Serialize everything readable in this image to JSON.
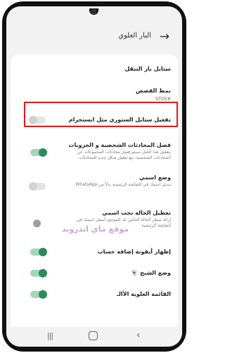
{
  "header": {
    "title": "البار العلوي",
    "back_icon": "arrow-right-icon"
  },
  "settings": [
    {
      "key": "statusbar_style",
      "label": "ستايل بار التنقل"
    },
    {
      "key": "stories_mode",
      "label": "نمط القصص",
      "value": "STOCK"
    },
    {
      "key": "insta_stories",
      "label": "تفعيل ستايل الستوري مثل انستجرام",
      "toggle": false,
      "highlighted": true
    },
    {
      "key": "separate_chats",
      "label": "فصل المحادثات الشخصية و الجروبات",
      "sub": "بتفعيل هذا الخيار سيتم فصل محادثات المجموعات عن المحادثات الشخصية، مع تفعيل شكل جديد للمحادثات.",
      "toggle": true
    },
    {
      "key": "show_name",
      "label": "وضع اسمي",
      "sub": "تبديل اسمك في الشاشة الرئيسية بدلاً من WhatsApp",
      "toggle": false
    },
    {
      "key": "status_under_name",
      "label": "تعطيل الحالة تحت اسمي",
      "sub": "إزالة سطر الحالة الخاص بك الموجود أسفل اسمك في الشاشة الرئيسية",
      "toggle": null
    },
    {
      "key": "add_account_icon",
      "label": "إظهار أيقونة إضافة حساب",
      "toggle": true
    },
    {
      "key": "ghost_mode",
      "label": "وضع الشبح 👻",
      "toggle": true
    },
    {
      "key": "extra_item",
      "label": "القائمة العلوية الأالـ",
      "toggle": true
    }
  ],
  "watermark": "موقع ماي اندرويد",
  "nav": {
    "recent_icon": "recent-apps-icon",
    "home_icon": "home-icon",
    "back_icon": "back-chevron-icon",
    "recent_glyph": "|||",
    "back_glyph": "‹"
  },
  "colors": {
    "accent_green": "#2e8b57",
    "highlight_red": "#e11b1b"
  }
}
